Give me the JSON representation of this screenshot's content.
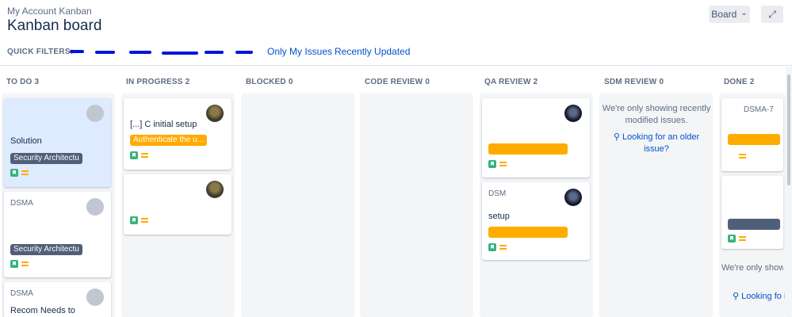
{
  "header": {
    "breadcrumb": "My Account Kanban",
    "title": "Kanban board",
    "board_button": "Board",
    "board_chevron": "⌄",
    "expand_icon": "⤢"
  },
  "quick_filters": {
    "label": "QUICK FILTERS:",
    "items": [
      "Only My Issues",
      "Recently Updated"
    ]
  },
  "columns": [
    {
      "title": "TO DO",
      "count": "3"
    },
    {
      "title": "IN PROGRESS",
      "count": "2"
    },
    {
      "title": "BLOCKED",
      "count": "0"
    },
    {
      "title": "CODE REVIEW",
      "count": "0"
    },
    {
      "title": "QA REVIEW",
      "count": "2"
    },
    {
      "title": "SDM REVIEW",
      "count": "0"
    },
    {
      "title": "DONE",
      "count": "2"
    }
  ],
  "cards": {
    "todo_1": {
      "summary": "Solution",
      "epic": "Security Architectu"
    },
    "todo_2": {
      "key": "DSMA",
      "epic": "Security Architectu"
    },
    "todo_3": {
      "key": "DSMA",
      "summary": "Recom Needs to"
    },
    "inprogress_1": {
      "summary": "[...] C initial setup",
      "epic": "Authenticate the u..."
    },
    "qa_2": {
      "key": "DSM",
      "summary": "setup"
    },
    "done_1": {
      "key": "DSMA-7"
    }
  },
  "sdm_review": {
    "info": "We're only showing recently modified issues.",
    "link": "Looking for an older issue?"
  },
  "done_info": {
    "info": "We're only show modified is",
    "link": "Looking fo issue?"
  },
  "colors": {
    "accent": "#0052cc",
    "epic_orange": "#ffab00",
    "epic_dark": "#505f79",
    "story_green": "#36b37e"
  }
}
